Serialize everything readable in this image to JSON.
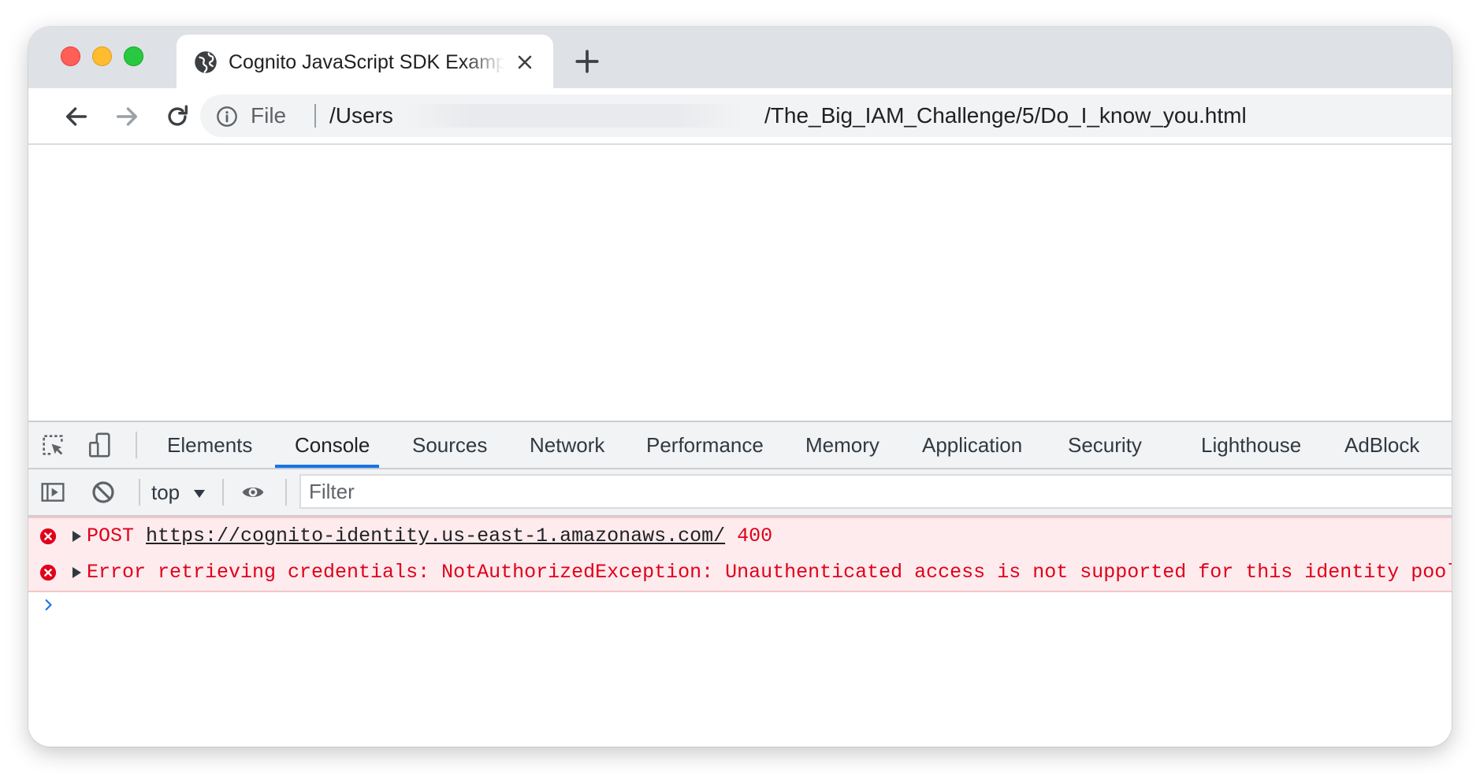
{
  "tab": {
    "title": "Cognito JavaScript SDK Example"
  },
  "omnibox": {
    "scheme_label": "File",
    "path_prefix": "/Users",
    "path_suffix": "/The_Big_IAM_Challenge/5/Do_I_know_you.html"
  },
  "devtools": {
    "tabs": [
      "Elements",
      "Console",
      "Sources",
      "Network",
      "Performance",
      "Memory",
      "Application",
      "Security",
      "Lighthouse",
      "AdBlock"
    ],
    "active_tab": "Console",
    "context": "top",
    "filter_placeholder": "Filter"
  },
  "console": {
    "messages": [
      {
        "level": "error",
        "method": "POST",
        "url": "https://cognito-identity.us-east-1.amazonaws.com/",
        "status": "400"
      },
      {
        "level": "error",
        "text": "Error retrieving credentials: NotAuthorizedException: Unauthenticated access is not supported for this identity pool."
      }
    ]
  },
  "colors": {
    "error_red": "#e0001b",
    "error_bg": "#fdebed",
    "active_tab_underline": "#1a73e8"
  },
  "icons": [
    "globe-icon",
    "close-icon",
    "plus-icon",
    "back-arrow-icon",
    "forward-arrow-icon",
    "reload-icon",
    "info-icon",
    "inspect-element-icon",
    "device-toolbar-icon",
    "sidebar-toggle-icon",
    "clear-console-icon",
    "eye-icon",
    "error-icon",
    "expand-triangle-icon",
    "prompt-chevron-icon"
  ]
}
